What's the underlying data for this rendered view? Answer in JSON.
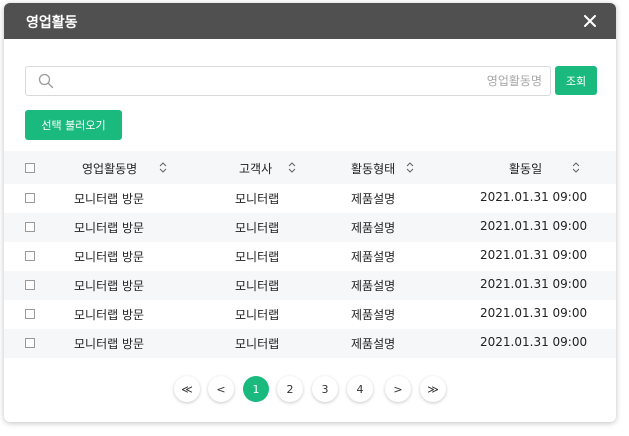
{
  "modal": {
    "title": "영업활동"
  },
  "search": {
    "value": "",
    "placeholder": "영업활동명",
    "button_label": "조회"
  },
  "load_button_label": "선택 불러오기",
  "table": {
    "headers": {
      "name": "영업활동명",
      "customer": "고객사",
      "type": "활동형태",
      "date": "활동일"
    },
    "rows": [
      {
        "name": "모니터랩 방문",
        "customer": "모니터랩",
        "type": "제품설명",
        "date": "2021.01.31  09:00"
      },
      {
        "name": "모니터랩 방문",
        "customer": "모니터랩",
        "type": "제품설명",
        "date": "2021.01.31  09:00"
      },
      {
        "name": "모니터랩 방문",
        "customer": "모니터랩",
        "type": "제품설명",
        "date": "2021.01.31  09:00"
      },
      {
        "name": "모니터랩 방문",
        "customer": "모니터랩",
        "type": "제품설명",
        "date": "2021.01.31  09:00"
      },
      {
        "name": "모니터랩 방문",
        "customer": "모니터랩",
        "type": "제품설명",
        "date": "2021.01.31  09:00"
      },
      {
        "name": "모니터랩 방문",
        "customer": "모니터랩",
        "type": "제품설명",
        "date": "2021.01.31  09:00"
      }
    ]
  },
  "pagination": {
    "first": "≪",
    "prev": "<",
    "pages": [
      "1",
      "2",
      "3",
      "4"
    ],
    "current": "1",
    "next": ">",
    "last": "≫"
  },
  "colors": {
    "header_bg": "#505050",
    "accent": "#1aba7e",
    "row_alt": "#f6f7f9"
  },
  "icons": {
    "close": "close-icon",
    "search": "search-icon",
    "sort": "sort-icon"
  }
}
